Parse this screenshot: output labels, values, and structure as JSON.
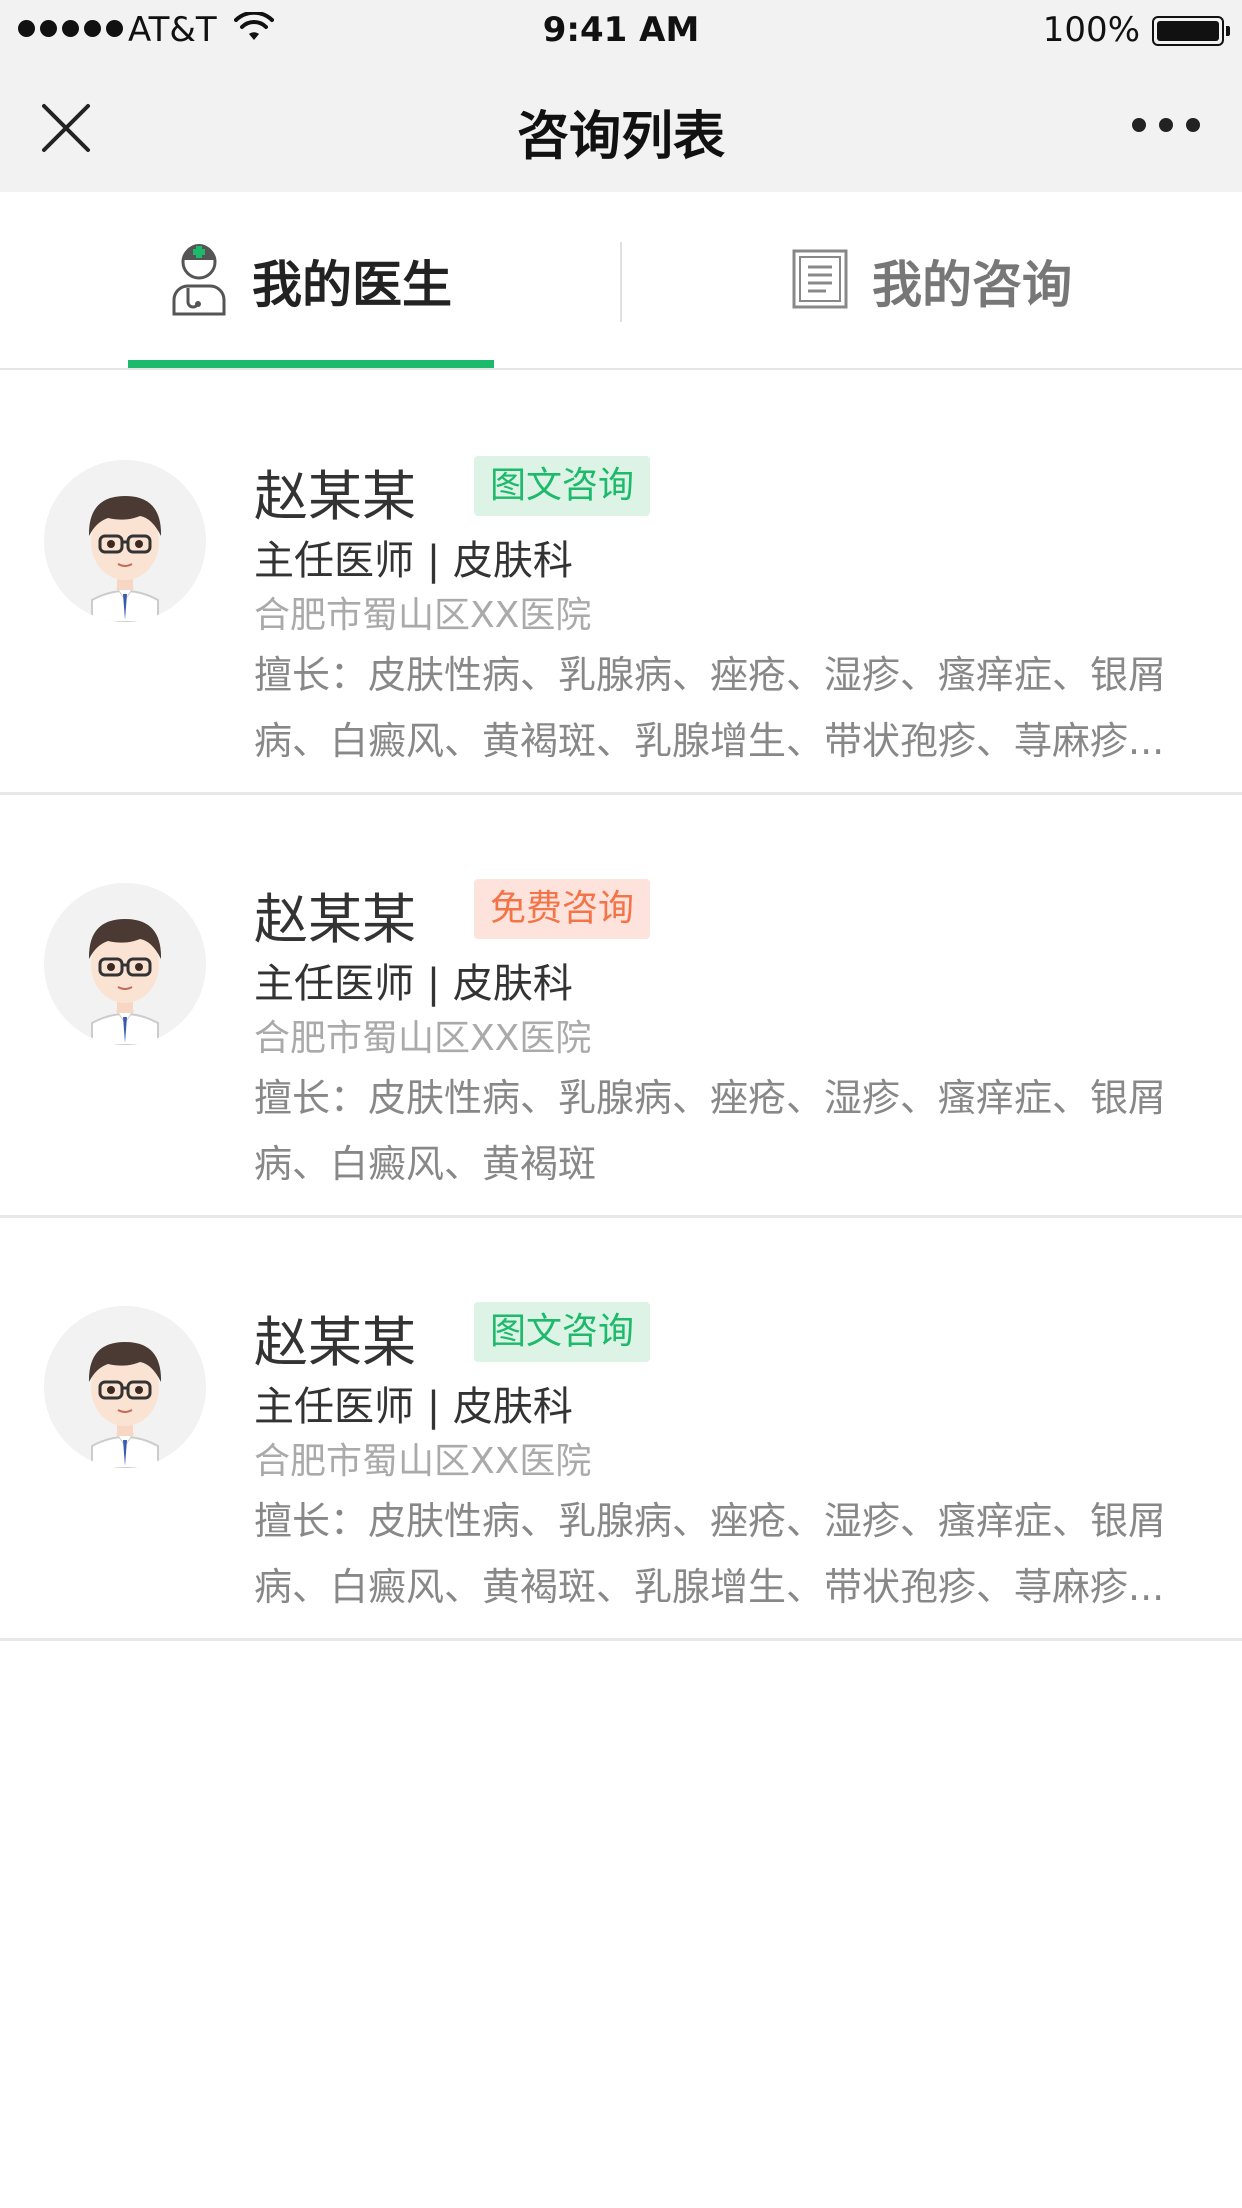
{
  "status_bar": {
    "carrier": "AT&T",
    "time": "9:41 AM",
    "battery": "100%"
  },
  "nav": {
    "title": "咨询列表"
  },
  "tabs": [
    {
      "label": "我的医生",
      "icon": "doctor-icon",
      "active": true
    },
    {
      "label": "我的咨询",
      "icon": "document-icon",
      "active": false
    }
  ],
  "colors": {
    "accent": "#1dba6b",
    "tag_green_bg": "#dcf3e6",
    "tag_orange_text": "#f4744a",
    "tag_orange_bg": "#fde3db"
  },
  "doctors": [
    {
      "name": "赵某某",
      "tag": "图文咨询",
      "tag_type": "green",
      "title": "主任医师 | 皮肤科",
      "hospital": "合肥市蜀山区XX医院",
      "skill": "擅长：皮肤性病、乳腺病、痤疮、湿疹、瘙痒症、银屑病、白癜风、黄褐斑、乳腺增生、带状孢疹、荨麻疹..."
    },
    {
      "name": "赵某某",
      "tag": "免费咨询",
      "tag_type": "orange",
      "title": "主任医师 | 皮肤科",
      "hospital": "合肥市蜀山区XX医院",
      "skill": "擅长：皮肤性病、乳腺病、痤疮、湿疹、瘙痒症、银屑病、白癜风、黄褐斑"
    },
    {
      "name": "赵某某",
      "tag": "图文咨询",
      "tag_type": "green",
      "title": "主任医师 | 皮肤科",
      "hospital": "合肥市蜀山区XX医院",
      "skill": "擅长：皮肤性病、乳腺病、痤疮、湿疹、瘙痒症、银屑病、白癜风、黄褐斑、乳腺增生、带状孢疹、荨麻疹..."
    }
  ]
}
